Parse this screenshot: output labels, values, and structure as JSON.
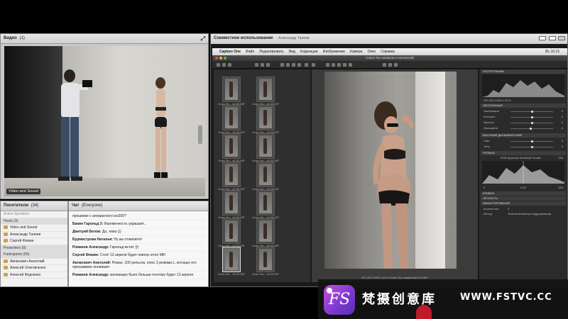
{
  "video_panel": {
    "title": "Видео",
    "count": "(1)",
    "label": "Video and Sound"
  },
  "attendees": {
    "title": "Посетители",
    "count": "(34)",
    "rows": [
      {
        "text": "Active Speakers",
        "kind": "grey"
      },
      {
        "text": "Hosts (3)",
        "kind": "group"
      },
      {
        "text": "Video and Sound",
        "kind": "person"
      },
      {
        "text": "Александр Талеев",
        "kind": "person"
      },
      {
        "text": "Сергей Фомин",
        "kind": "person"
      },
      {
        "text": "Presenters (0)",
        "kind": "group"
      },
      {
        "text": "Participants (55)",
        "kind": "group"
      },
      {
        "text": "Авласевич Анатолий",
        "kind": "person"
      },
      {
        "text": "Алексей Олеговченко",
        "kind": "person"
      },
      {
        "text": "Алексей Федченко",
        "kind": "person"
      }
    ]
  },
  "chat": {
    "title": "Чат",
    "scope": "(Everyone)",
    "messages": [
      {
        "name": "",
        "text": "прошивке с аппаратного iso200?"
      },
      {
        "name": "Бакин Гарольд 3:",
        "text": " беременность украшает..."
      },
      {
        "name": "Дмитрий Белов:",
        "text": " Да, тема )))"
      },
      {
        "name": "Бурмистрова Наталья:",
        "text": " Ну вы отжигаете!"
      },
      {
        "name": "Романов Александр:",
        "text": " Гарольд мстит )))"
      },
      {
        "name": "Сергей Фомин:",
        "text": " Стоп! 13 апреля будет повтор этого МК!"
      },
      {
        "name": "Авласевич Анатолий:",
        "text": " Роман, 100 рельсов, плюс 3 режима L, которых его программно понижают"
      },
      {
        "name": "Романов Александр:",
        "text": " желающих было больше поэтому будет 13 апреля"
      }
    ]
  },
  "share": {
    "title": "Совместное использование",
    "subtitle": "- Александр Талеев",
    "menubar": {
      "apple": "",
      "items": [
        "Capture One",
        "Файл",
        "Редактировать",
        "Вид",
        "Коррекции",
        "Изображение",
        "Камера",
        "Окно",
        "Справка"
      ],
      "clock": "Вс 16:15"
    },
    "doc_title": "Сеанс без названия.cosessiondb",
    "thumb_caption": "Сеанс без... а0138.NEF",
    "viewer_status": "ISO 200   1/250 s   f/2.8        Сеанс без названия0134.NEF",
    "tools": {
      "histogram": "ГИСТОГРАММА",
      "histo_info": "ISO 200      1/250 s      f/2.8",
      "exposure": "ЭКСПОЗИЦИЯ",
      "exposure_rows": [
        {
          "label": "Экспозиция",
          "value": "0",
          "pos": 0.5
        },
        {
          "label": "Контраст",
          "value": "0",
          "pos": 0.5
        },
        {
          "label": "Яркость",
          "value": "0",
          "pos": 0.5
        },
        {
          "label": "Насыщенн.",
          "value": "-4",
          "pos": 0.47
        }
      ],
      "hdr": "ВЫСОКИЙ ДИНАМИЧЕСКИЙ",
      "hdr_rows": [
        {
          "label": "Свет",
          "value": "0"
        },
        {
          "label": "Тень",
          "value": "0"
        }
      ],
      "levels": "УРОВНИ",
      "levels_mode": "RGB   Красный  Зеленый  Синий",
      "levels_values": {
        "left": "0",
        "mid": "0,00",
        "right": "255",
        "left2": "0",
        "right2": "255"
      },
      "curve": "КРИВАЯ",
      "clarity": "ЧЕТКОСТЬ",
      "vignette": "ВИНЬЕТИРОВАНИЕ",
      "vignette_rows": [
        {
          "label": "Количество",
          "value": "0"
        },
        {
          "label": "Метод",
          "value": "Элиптический при кадрировании"
        }
      ]
    }
  },
  "banner": {
    "logo": "FS",
    "brand": "梵摄创意库",
    "url": "WWW.FSTVC.CC"
  },
  "colors": {
    "logo": "#9b45d6",
    "record": "#c01a2a"
  }
}
